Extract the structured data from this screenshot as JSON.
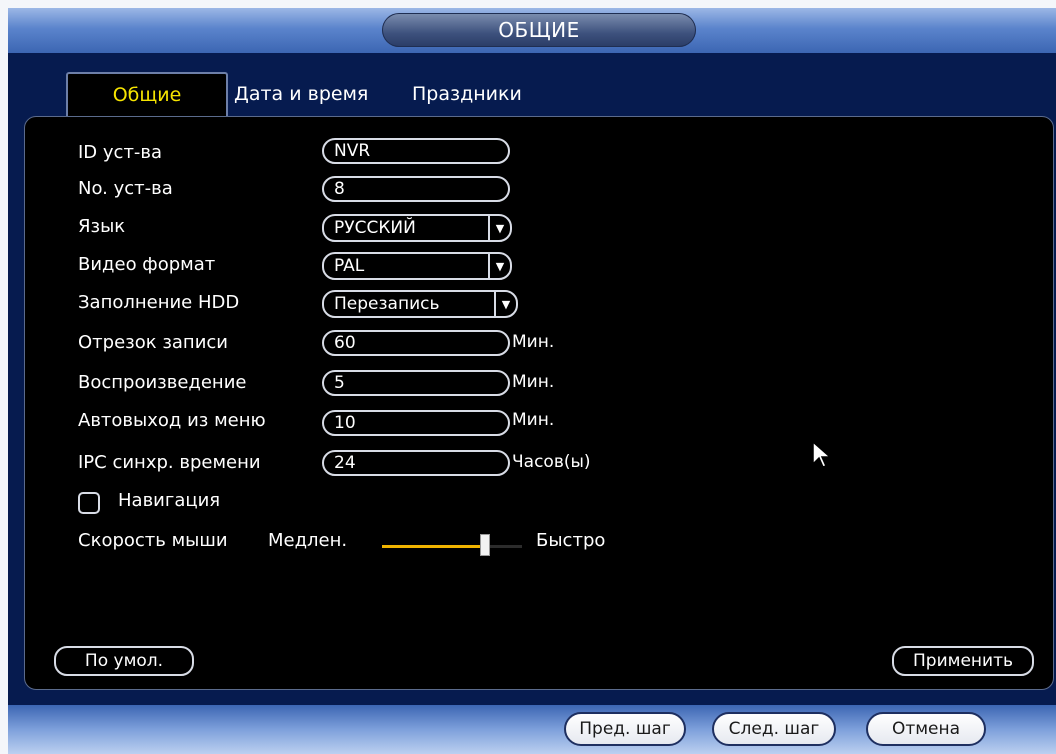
{
  "window": {
    "title": "ОБЩИЕ"
  },
  "tabs": [
    {
      "label": "Общие",
      "active": true
    },
    {
      "label": "Дата и время",
      "active": false
    },
    {
      "label": "Праздники",
      "active": false
    }
  ],
  "form": {
    "device_id": {
      "label": "ID уст-ва",
      "value": "NVR"
    },
    "device_no": {
      "label": "No. уст-ва",
      "value": "8"
    },
    "language": {
      "label": "Язык",
      "value": "РУССКИЙ"
    },
    "video_format": {
      "label": "Видео формат",
      "value": "PAL"
    },
    "hdd_full": {
      "label": "Заполнение HDD",
      "value": "Перезапись"
    },
    "record_segment": {
      "label": "Отрезок записи",
      "value": "60",
      "unit": "Мин."
    },
    "playback": {
      "label": "Воспроизведение",
      "value": "5",
      "unit": "Мин."
    },
    "auto_logout": {
      "label": "Автовыход из меню",
      "value": "10",
      "unit": "Мин."
    },
    "ipc_sync": {
      "label": "IPC синхр. времени",
      "value": "24",
      "unit": "Часов(ы)"
    },
    "navigation": {
      "label": "Навигация",
      "checked": false
    },
    "mouse_speed": {
      "label": "Скорость мыши",
      "min_label": "Медлен.",
      "max_label": "Быстро",
      "level": 0.75
    }
  },
  "buttons": {
    "default": "По умол.",
    "apply": "Применить"
  },
  "footer": {
    "prev": "Пред. шаг",
    "next": "След. шаг",
    "cancel": "Отмена"
  },
  "colors": {
    "title_bar": "#5b84cc",
    "active_tab_text": "#f6e400",
    "panel_bg": "#000000",
    "slider_fill": "#f0b400"
  },
  "icons": {
    "dropdown": "chevron-down-icon",
    "cursor": "mouse-pointer-icon"
  }
}
